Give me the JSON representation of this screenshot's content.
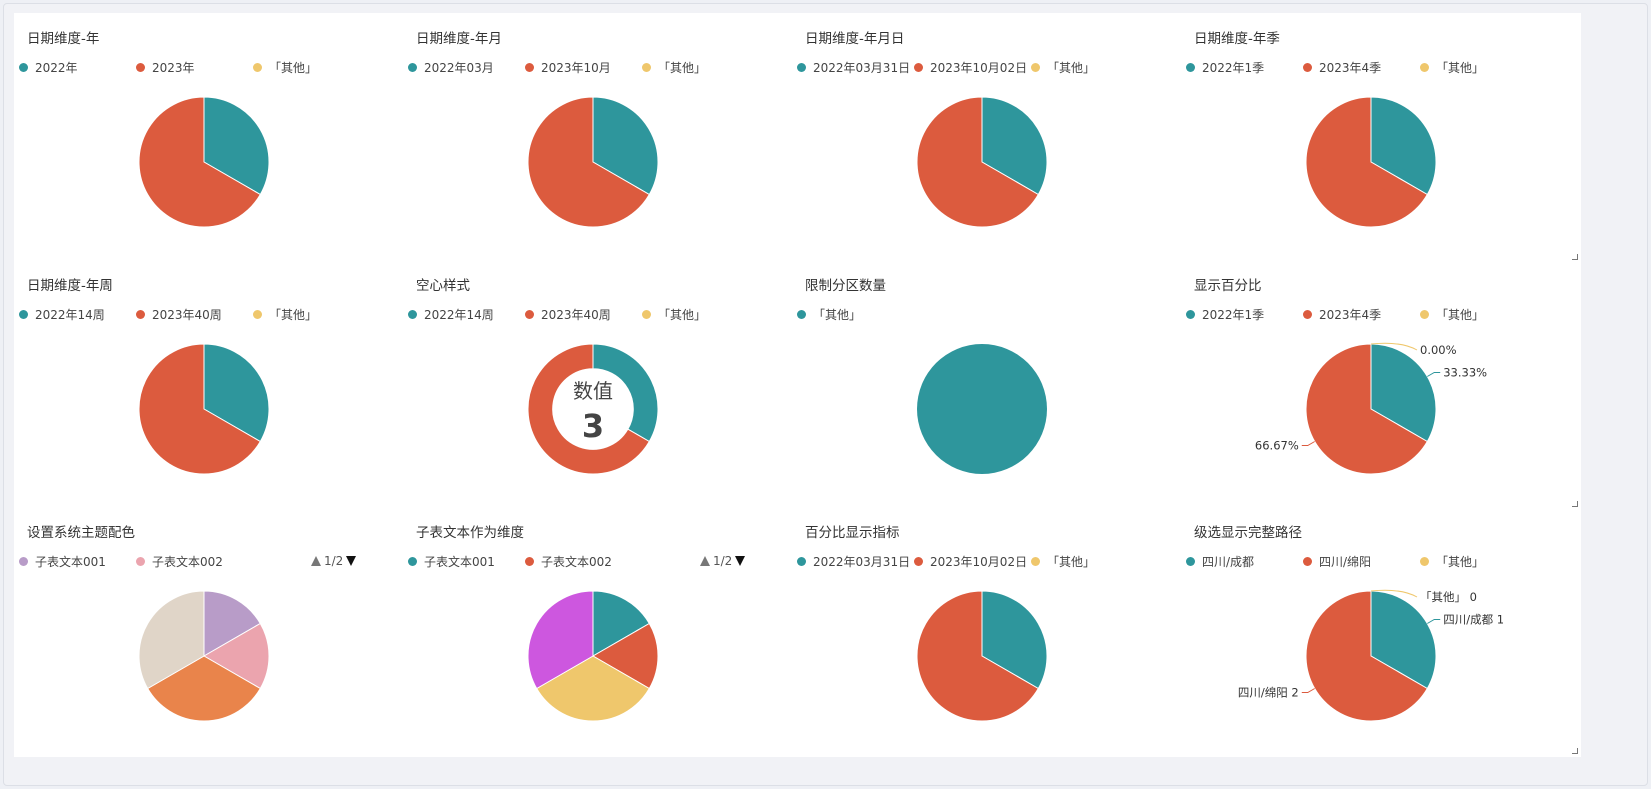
{
  "colors": {
    "teal": "#2e969c",
    "orange_red": "#dc5b3e",
    "yellow": "#efc76c",
    "purple": "#b89cc8",
    "pink": "#eba4ae",
    "orange": "#e9844b",
    "beige": "#e0d5c8",
    "magenta": "#cd57df"
  },
  "cards": [
    {
      "title": "日期维度-年",
      "legend": [
        {
          "label": "2022年",
          "color": "#2e969c"
        },
        {
          "label": "2023年",
          "color": "#dc5b3e"
        },
        {
          "label": "「其他」",
          "color": "#efc76c"
        }
      ]
    },
    {
      "title": "日期维度-年月",
      "legend": [
        {
          "label": "2022年03月",
          "color": "#2e969c"
        },
        {
          "label": "2023年10月",
          "color": "#dc5b3e"
        },
        {
          "label": "「其他」",
          "color": "#efc76c"
        }
      ]
    },
    {
      "title": "日期维度-年月日",
      "legend": [
        {
          "label": "2022年03月31日",
          "color": "#2e969c"
        },
        {
          "label": "2023年10月02日",
          "color": "#dc5b3e"
        },
        {
          "label": "「其他」",
          "color": "#efc76c"
        }
      ]
    },
    {
      "title": "日期维度-年季",
      "legend": [
        {
          "label": "2022年1季",
          "color": "#2e969c"
        },
        {
          "label": "2023年4季",
          "color": "#dc5b3e"
        },
        {
          "label": "「其他」",
          "color": "#efc76c"
        }
      ]
    },
    {
      "title": "日期维度-年周",
      "legend": [
        {
          "label": "2022年14周",
          "color": "#2e969c"
        },
        {
          "label": "2023年40周",
          "color": "#dc5b3e"
        },
        {
          "label": "「其他」",
          "color": "#efc76c"
        }
      ]
    },
    {
      "title": "空心样式",
      "legend": [
        {
          "label": "2022年14周",
          "color": "#2e969c"
        },
        {
          "label": "2023年40周",
          "color": "#dc5b3e"
        },
        {
          "label": "「其他」",
          "color": "#efc76c"
        }
      ],
      "center": {
        "label": "数值",
        "value": "3"
      }
    },
    {
      "title": "限制分区数量",
      "legend": [
        {
          "label": "「其他」",
          "color": "#2e969c"
        }
      ]
    },
    {
      "title": "显示百分比",
      "legend": [
        {
          "label": "2022年1季",
          "color": "#2e969c"
        },
        {
          "label": "2023年4季",
          "color": "#dc5b3e"
        },
        {
          "label": "「其他」",
          "color": "#efc76c"
        }
      ],
      "slice_labels": [
        "33.33%",
        "66.67%",
        "0.00%"
      ]
    },
    {
      "title": "设置系统主题配色",
      "legend": [
        {
          "label": "子表文本001",
          "color": "#b89cc8"
        },
        {
          "label": "子表文本002",
          "color": "#eba4ae"
        }
      ],
      "pager": "1/2"
    },
    {
      "title": "子表文本作为维度",
      "legend": [
        {
          "label": "子表文本001",
          "color": "#2e969c"
        },
        {
          "label": "子表文本002",
          "color": "#dc5b3e"
        }
      ],
      "pager": "1/2"
    },
    {
      "title": "百分比显示指标",
      "legend": [
        {
          "label": "2022年03月31日",
          "color": "#2e969c"
        },
        {
          "label": "2023年10月02日",
          "color": "#dc5b3e"
        },
        {
          "label": "「其他」",
          "color": "#efc76c"
        }
      ]
    },
    {
      "title": "级选显示完整路径",
      "legend": [
        {
          "label": "四川/成都",
          "color": "#2e969c"
        },
        {
          "label": "四川/绵阳",
          "color": "#dc5b3e"
        },
        {
          "label": "「其他」",
          "color": "#efc76c"
        }
      ],
      "slice_labels": [
        "四川/成都 1",
        "四川/绵阳 2",
        "「其他」 0"
      ]
    }
  ],
  "chart_data": [
    {
      "type": "pie",
      "title": "日期维度-年",
      "categories": [
        "2022年",
        "2023年",
        "「其他」"
      ],
      "values": [
        1,
        2,
        0
      ],
      "colors": [
        "#2e969c",
        "#dc5b3e",
        "#efc76c"
      ]
    },
    {
      "type": "pie",
      "title": "日期维度-年月",
      "categories": [
        "2022年03月",
        "2023年10月",
        "「其他」"
      ],
      "values": [
        1,
        2,
        0
      ],
      "colors": [
        "#2e969c",
        "#dc5b3e",
        "#efc76c"
      ]
    },
    {
      "type": "pie",
      "title": "日期维度-年月日",
      "categories": [
        "2022年03月31日",
        "2023年10月02日",
        "「其他」"
      ],
      "values": [
        1,
        2,
        0
      ],
      "colors": [
        "#2e969c",
        "#dc5b3e",
        "#efc76c"
      ]
    },
    {
      "type": "pie",
      "title": "日期维度-年季",
      "categories": [
        "2022年1季",
        "2023年4季",
        "「其他」"
      ],
      "values": [
        1,
        2,
        0
      ],
      "colors": [
        "#2e969c",
        "#dc5b3e",
        "#efc76c"
      ]
    },
    {
      "type": "pie",
      "title": "日期维度-年周",
      "categories": [
        "2022年14周",
        "2023年40周",
        "「其他」"
      ],
      "values": [
        1,
        2,
        0
      ],
      "colors": [
        "#2e969c",
        "#dc5b3e",
        "#efc76c"
      ]
    },
    {
      "type": "pie",
      "donut": true,
      "title": "空心样式",
      "categories": [
        "2022年14周",
        "2023年40周",
        "「其他」"
      ],
      "values": [
        1,
        2,
        0
      ],
      "colors": [
        "#2e969c",
        "#dc5b3e",
        "#efc76c"
      ]
    },
    {
      "type": "pie",
      "title": "限制分区数量",
      "categories": [
        "「其他」"
      ],
      "values": [
        3
      ],
      "colors": [
        "#2e969c"
      ]
    },
    {
      "type": "pie",
      "title": "显示百分比",
      "categories": [
        "2022年1季",
        "2023年4季",
        "「其他」"
      ],
      "values": [
        1,
        2,
        0
      ],
      "colors": [
        "#2e969c",
        "#dc5b3e",
        "#efc76c"
      ]
    },
    {
      "type": "pie",
      "title": "设置系统主题配色",
      "categories": [
        "子表文本001",
        "子表文本002",
        "",
        "",
        ""
      ],
      "values": [
        1,
        1,
        2,
        2,
        0
      ],
      "colors": [
        "#b89cc8",
        "#eba4ae",
        "#e9844b",
        "#e0d5c8",
        "#e0d5c8"
      ]
    },
    {
      "type": "pie",
      "title": "子表文本作为维度",
      "categories": [
        "子表文本001",
        "子表文本002",
        "",
        "",
        ""
      ],
      "values": [
        1,
        1,
        2,
        2,
        0
      ],
      "colors": [
        "#2e969c",
        "#dc5b3e",
        "#efc76c",
        "#cd57df",
        "#cd57df"
      ]
    },
    {
      "type": "pie",
      "title": "百分比显示指标",
      "categories": [
        "2022年03月31日",
        "2023年10月02日",
        "「其他」"
      ],
      "values": [
        1,
        2,
        0
      ],
      "colors": [
        "#2e969c",
        "#dc5b3e",
        "#efc76c"
      ]
    },
    {
      "type": "pie",
      "title": "级选显示完整路径",
      "categories": [
        "四川/成都",
        "四川/绵阳",
        "「其他」"
      ],
      "values": [
        1,
        2,
        0
      ],
      "colors": [
        "#2e969c",
        "#dc5b3e",
        "#efc76c"
      ]
    }
  ]
}
